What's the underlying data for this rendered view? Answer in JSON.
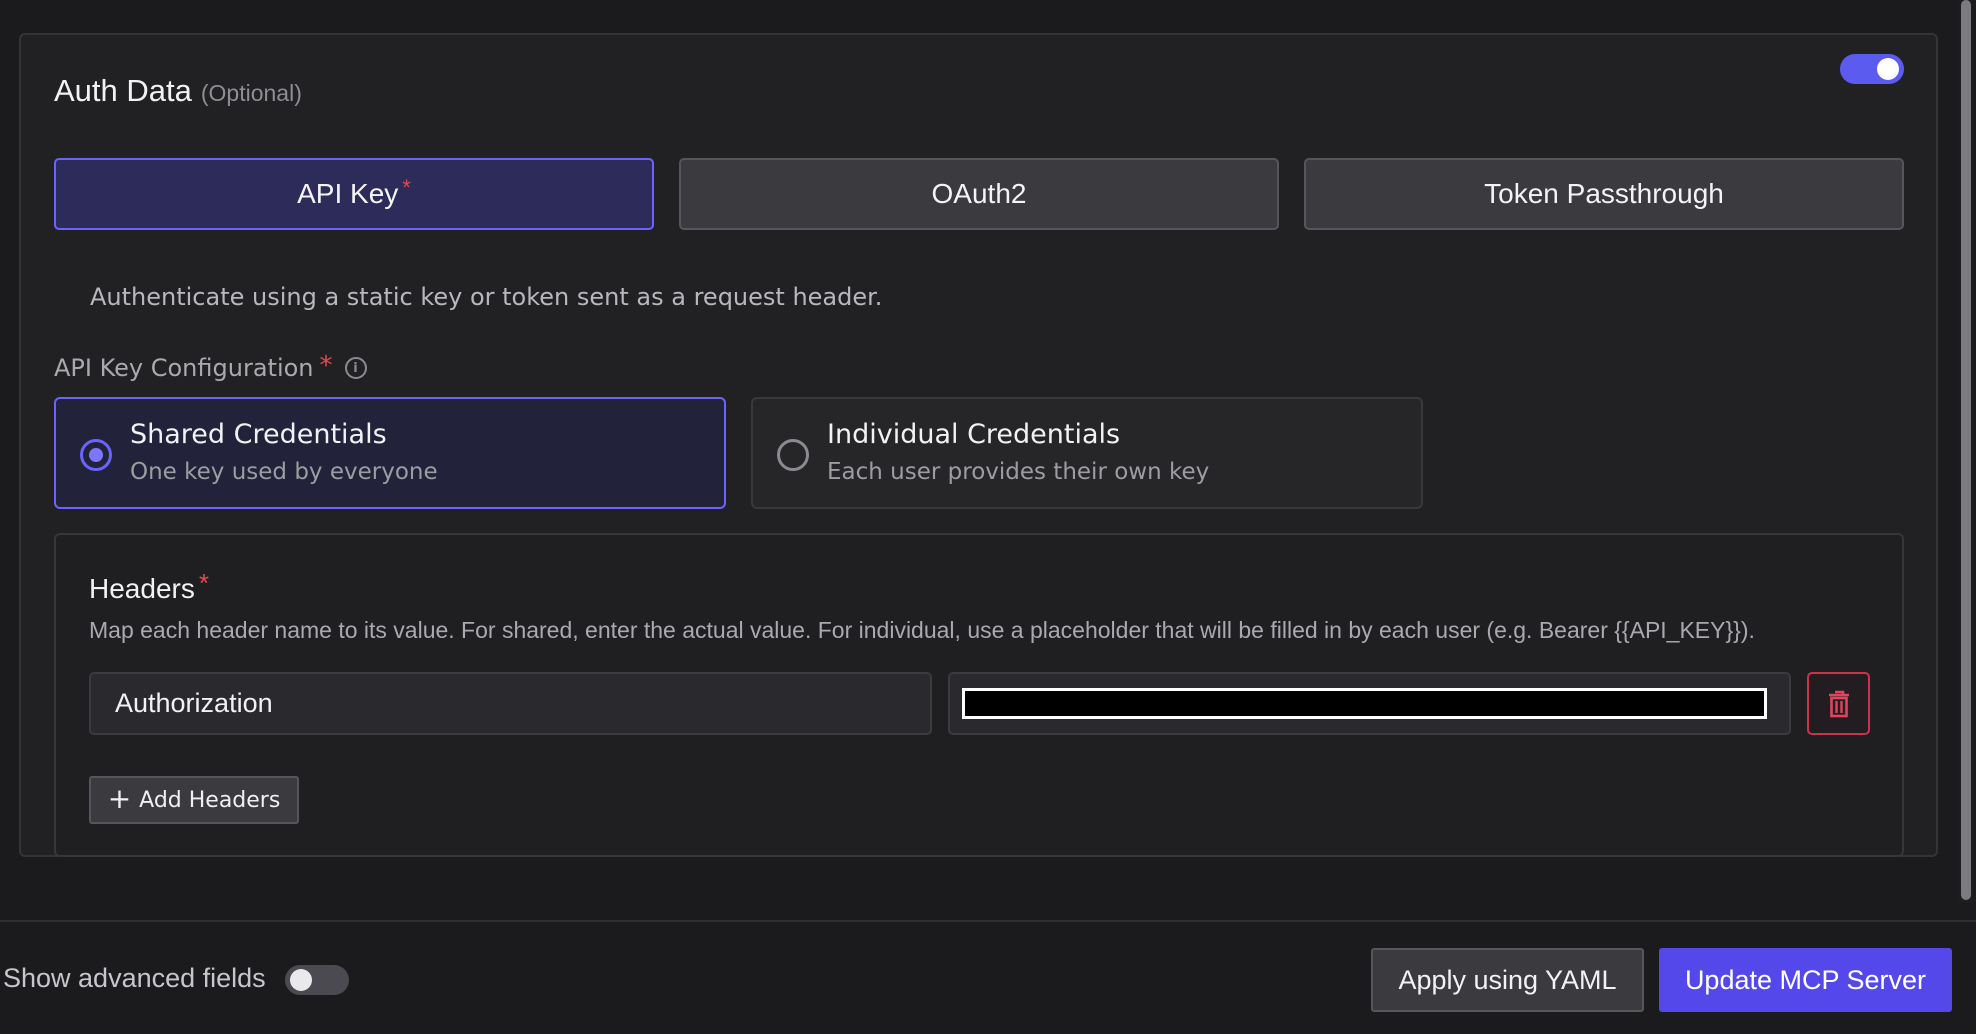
{
  "auth": {
    "title": "Auth Data",
    "optional_label": "(Optional)",
    "enabled": true
  },
  "tabs": [
    {
      "label": "API Key",
      "required_mark": "*",
      "active": true
    },
    {
      "label": "OAuth2",
      "active": false
    },
    {
      "label": "Token Passthrough",
      "active": false
    }
  ],
  "tab_description": "Authenticate using a static key or token sent as a request header.",
  "api_key_config": {
    "label": "API Key Configuration",
    "required_mark": "*",
    "info_icon": "info-icon",
    "options": [
      {
        "title": "Shared Credentials",
        "subtitle": "One key used by everyone",
        "selected": true
      },
      {
        "title": "Individual Credentials",
        "subtitle": "Each user provides their own key",
        "selected": false
      }
    ]
  },
  "headers": {
    "title": "Headers",
    "required_mark": "*",
    "description": "Map each header name to its value. For shared, enter the actual value. For individual, use a placeholder that will be filled in by each user (e.g. Bearer {{API_KEY}}).",
    "rows": [
      {
        "name": "Authorization",
        "value": "",
        "value_redacted": true
      }
    ],
    "add_label": "Add Headers",
    "add_icon": "plus-icon",
    "delete_icon": "trash-icon"
  },
  "footer": {
    "advanced_label": "Show advanced fields",
    "advanced_enabled": false,
    "yaml_button": "Apply using YAML",
    "update_button": "Update MCP Server"
  },
  "colors": {
    "accent": "#5b5bf0",
    "primary_button": "#5548ea",
    "required": "#e5484d",
    "danger": "#c9344a",
    "background": "#1b1b1e",
    "card": "#212124"
  }
}
